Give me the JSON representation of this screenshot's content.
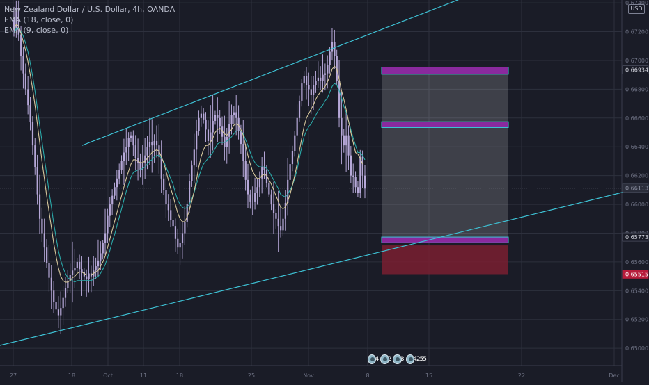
{
  "legend": {
    "symbol": "New Zealand Dollar / U.S. Dollar, 4h, OANDA",
    "ema1": "EMA (18, close, 0)",
    "ema2": "EMA (9, close, 0)"
  },
  "currency": "USD",
  "events": {
    "count1": "4",
    "count2": "2",
    "count3": "3",
    "count4": "4",
    "count5": "2",
    "count6": "5",
    "count7": "5"
  },
  "colors": {
    "background": "#1a1c27",
    "grid": "#2d303d",
    "candle": "#b6a8d8",
    "ema_slow": "#2aa9a9",
    "ema_fast": "#d7c89c",
    "channel": "#3ec3d6",
    "target_box": "#8a2a9e",
    "target_border": "#3ec3d6",
    "stop_zone": "#7a1f31",
    "price_highlight": "#b71c3b"
  },
  "chart_data": {
    "type": "line",
    "title": "New Zealand Dollar / U.S. Dollar, 4h, OANDA",
    "xlabel": "",
    "ylabel": "",
    "x_axis_labels": [
      "27",
      "18",
      "Oct",
      "11",
      "18",
      "25",
      "Nov",
      "8",
      "15",
      "22",
      "Dec"
    ],
    "y_ticks": [
      0.65,
      0.652,
      0.654,
      0.656,
      0.658,
      0.66,
      0.662,
      0.664,
      0.666,
      0.668,
      0.67,
      0.672,
      0.674
    ],
    "y_tick_labels": [
      "0.65000",
      "0.65200",
      "0.65400",
      "0.65600",
      "0.65800",
      "0.66000",
      "0.66200",
      "0.66400",
      "0.66600",
      "0.66800",
      "0.67000",
      "0.67200",
      "0.67400"
    ],
    "ylim": [
      0.6488,
      0.6742
    ],
    "grid": true,
    "price_labels": [
      {
        "label": "0.66934",
        "value": 0.66934,
        "style": "normal"
      },
      {
        "label": "0.66113",
        "value": 0.66113,
        "style": "muted"
      },
      {
        "label": "0.65773",
        "value": 0.65773,
        "style": "normal"
      },
      {
        "label": "0.65515",
        "value": 0.65515,
        "style": "red"
      }
    ],
    "trend_lines": [
      {
        "name": "channel_upper",
        "from": [
          118,
          0.6641
        ],
        "to": [
          700,
          0.675
        ]
      },
      {
        "name": "channel_lower_mid",
        "from": [
          0,
          0.6511
        ],
        "to": [
          932,
          0.6613
        ]
      },
      {
        "name": "channel_lower_bottom",
        "from": [
          0,
          0.6511
        ],
        "to": [
          932,
          0.6512
        ]
      }
    ],
    "zones": {
      "box_x": [
        548,
        730
      ],
      "target_zone_1": [
        0.66904,
        0.66954
      ],
      "target_zone_2": [
        0.66534,
        0.66574
      ],
      "entry_zone": [
        0.65733,
        0.65773
      ],
      "stop_zone": [
        0.65515,
        0.65715
      ],
      "shade_from": 0.66954,
      "shade_to": 0.65773
    },
    "candles_x_range": [
      20,
      524
    ],
    "close": [
      0.6722,
      0.6736,
      0.6718,
      0.6703,
      0.6691,
      0.668,
      0.6669,
      0.6657,
      0.6641,
      0.6626,
      0.6607,
      0.659,
      0.658,
      0.657,
      0.6559,
      0.6549,
      0.654,
      0.6532,
      0.6527,
      0.6523,
      0.6528,
      0.6535,
      0.6542,
      0.6547,
      0.6551,
      0.6554,
      0.6556,
      0.656,
      0.6555,
      0.6553,
      0.655,
      0.6548,
      0.6552,
      0.655,
      0.6554,
      0.6557,
      0.6561,
      0.6566,
      0.6573,
      0.658,
      0.6592,
      0.66,
      0.6606,
      0.6612,
      0.6618,
      0.6624,
      0.663,
      0.6636,
      0.664,
      0.6646,
      0.6648,
      0.6641,
      0.6632,
      0.6629,
      0.6624,
      0.6629,
      0.6634,
      0.664,
      0.6643,
      0.6641,
      0.6644,
      0.6641,
      0.6633,
      0.6618,
      0.661,
      0.66,
      0.6596,
      0.6589,
      0.6585,
      0.6576,
      0.657,
      0.6573,
      0.658,
      0.6588,
      0.66,
      0.6616,
      0.6627,
      0.6638,
      0.6651,
      0.666,
      0.6663,
      0.6659,
      0.6652,
      0.6644,
      0.665,
      0.6658,
      0.6662,
      0.666,
      0.6654,
      0.6647,
      0.664,
      0.6647,
      0.6656,
      0.6662,
      0.6664,
      0.666,
      0.6651,
      0.6642,
      0.663,
      0.6617,
      0.6607,
      0.6602,
      0.6602,
      0.6608,
      0.6612,
      0.6618,
      0.6626,
      0.6624,
      0.6615,
      0.6607,
      0.66,
      0.6594,
      0.659,
      0.6585,
      0.6582,
      0.659,
      0.6601,
      0.6617,
      0.6628,
      0.6637,
      0.6648,
      0.666,
      0.6672,
      0.6684,
      0.6689,
      0.6683,
      0.668,
      0.6676,
      0.6683,
      0.6686,
      0.6688,
      0.6686,
      0.669,
      0.6691,
      0.6697,
      0.6706,
      0.6713,
      0.6703,
      0.6686,
      0.666,
      0.6648,
      0.6641,
      0.6648,
      0.6634,
      0.662,
      0.6619,
      0.6612,
      0.6608,
      0.6633,
      0.662,
      0.6611
    ],
    "ema_18": [
      0.6719,
      0.6722,
      0.6722,
      0.672,
      0.6717,
      0.6712,
      0.6706,
      0.6698,
      0.6689,
      0.6679,
      0.6667,
      0.6655,
      0.6644,
      0.6632,
      0.6621,
      0.6609,
      0.6598,
      0.6587,
      0.6577,
      0.6568,
      0.6561,
      0.6556,
      0.6552,
      0.6549,
      0.6548,
      0.6547,
      0.6546,
      0.6547,
      0.6547,
      0.6547,
      0.6547,
      0.6547,
      0.6547,
      0.6547,
      0.6548,
      0.6549,
      0.655,
      0.6552,
      0.6555,
      0.6558,
      0.6563,
      0.6568,
      0.6574,
      0.6579,
      0.6585,
      0.6591,
      0.6597,
      0.6603,
      0.6609,
      0.6614,
      0.6619,
      0.6622,
      0.6623,
      0.6624,
      0.6624,
      0.6625,
      0.6626,
      0.6628,
      0.663,
      0.6631,
      0.6633,
      0.6634,
      0.6634,
      0.6632,
      0.663,
      0.6626,
      0.6622,
      0.6618,
      0.6614,
      0.6608,
      0.6603,
      0.66,
      0.6598,
      0.6597,
      0.6598,
      0.66,
      0.6604,
      0.6608,
      0.6614,
      0.6619,
      0.6624,
      0.6628,
      0.663,
      0.6632,
      0.6634,
      0.6636,
      0.6639,
      0.6642,
      0.6643,
      0.6643,
      0.6643,
      0.6644,
      0.6645,
      0.6647,
      0.6649,
      0.6651,
      0.6651,
      0.6651,
      0.6649,
      0.6645,
      0.6641,
      0.6636,
      0.6632,
      0.6629,
      0.6627,
      0.6626,
      0.6626,
      0.6626,
      0.6625,
      0.6623,
      0.662,
      0.6617,
      0.6614,
      0.6611,
      0.6607,
      0.6606,
      0.6605,
      0.6607,
      0.661,
      0.6613,
      0.6618,
      0.6624,
      0.6632,
      0.664,
      0.6647,
      0.6651,
      0.6654,
      0.6656,
      0.6659,
      0.6662,
      0.6665,
      0.6667,
      0.6669,
      0.6672,
      0.6674,
      0.6678,
      0.6682,
      0.6684,
      0.6683,
      0.6679,
      0.6674,
      0.6668,
      0.6664,
      0.6658,
      0.6652,
      0.6646,
      0.6641,
      0.6636,
      0.6636,
      0.6634,
      0.6631
    ],
    "ema_9": [
      0.6722,
      0.6725,
      0.6724,
      0.6719,
      0.6713,
      0.6707,
      0.6699,
      0.669,
      0.668,
      0.6669,
      0.6656,
      0.6643,
      0.663,
      0.6618,
      0.6606,
      0.6595,
      0.6584,
      0.6573,
      0.6564,
      0.6556,
      0.655,
      0.6547,
      0.6546,
      0.6546,
      0.6547,
      0.6549,
      0.655,
      0.6552,
      0.6553,
      0.6553,
      0.6552,
      0.6551,
      0.6551,
      0.6551,
      0.6552,
      0.6553,
      0.6554,
      0.6557,
      0.656,
      0.6564,
      0.657,
      0.6576,
      0.6582,
      0.6588,
      0.6594,
      0.66,
      0.6606,
      0.6612,
      0.6618,
      0.6623,
      0.6628,
      0.6631,
      0.6631,
      0.663,
      0.6629,
      0.6629,
      0.663,
      0.6632,
      0.6634,
      0.6636,
      0.6637,
      0.6638,
      0.6637,
      0.6633,
      0.6629,
      0.6623,
      0.6617,
      0.6611,
      0.6606,
      0.66,
      0.6594,
      0.659,
      0.6588,
      0.6588,
      0.6591,
      0.6596,
      0.6602,
      0.6609,
      0.6617,
      0.6626,
      0.6633,
      0.6638,
      0.6641,
      0.6641,
      0.6643,
      0.6646,
      0.665,
      0.6652,
      0.6653,
      0.6651,
      0.6649,
      0.6648,
      0.665,
      0.6652,
      0.6655,
      0.6656,
      0.6655,
      0.6652,
      0.6648,
      0.6641,
      0.6634,
      0.6628,
      0.6623,
      0.662,
      0.6618,
      0.6618,
      0.662,
      0.6621,
      0.662,
      0.6617,
      0.6614,
      0.661,
      0.6606,
      0.6602,
      0.6598,
      0.6597,
      0.6598,
      0.6602,
      0.6607,
      0.6613,
      0.662,
      0.6628,
      0.6637,
      0.6646,
      0.6654,
      0.666,
      0.6663,
      0.6666,
      0.6669,
      0.6673,
      0.6676,
      0.6678,
      0.668,
      0.6682,
      0.6685,
      0.6689,
      0.6694,
      0.6696,
      0.6694,
      0.6687,
      0.6679,
      0.6673,
      0.6666,
      0.6658,
      0.665,
      0.6643,
      0.6636,
      0.6635,
      0.6632,
      0.6628
    ]
  }
}
